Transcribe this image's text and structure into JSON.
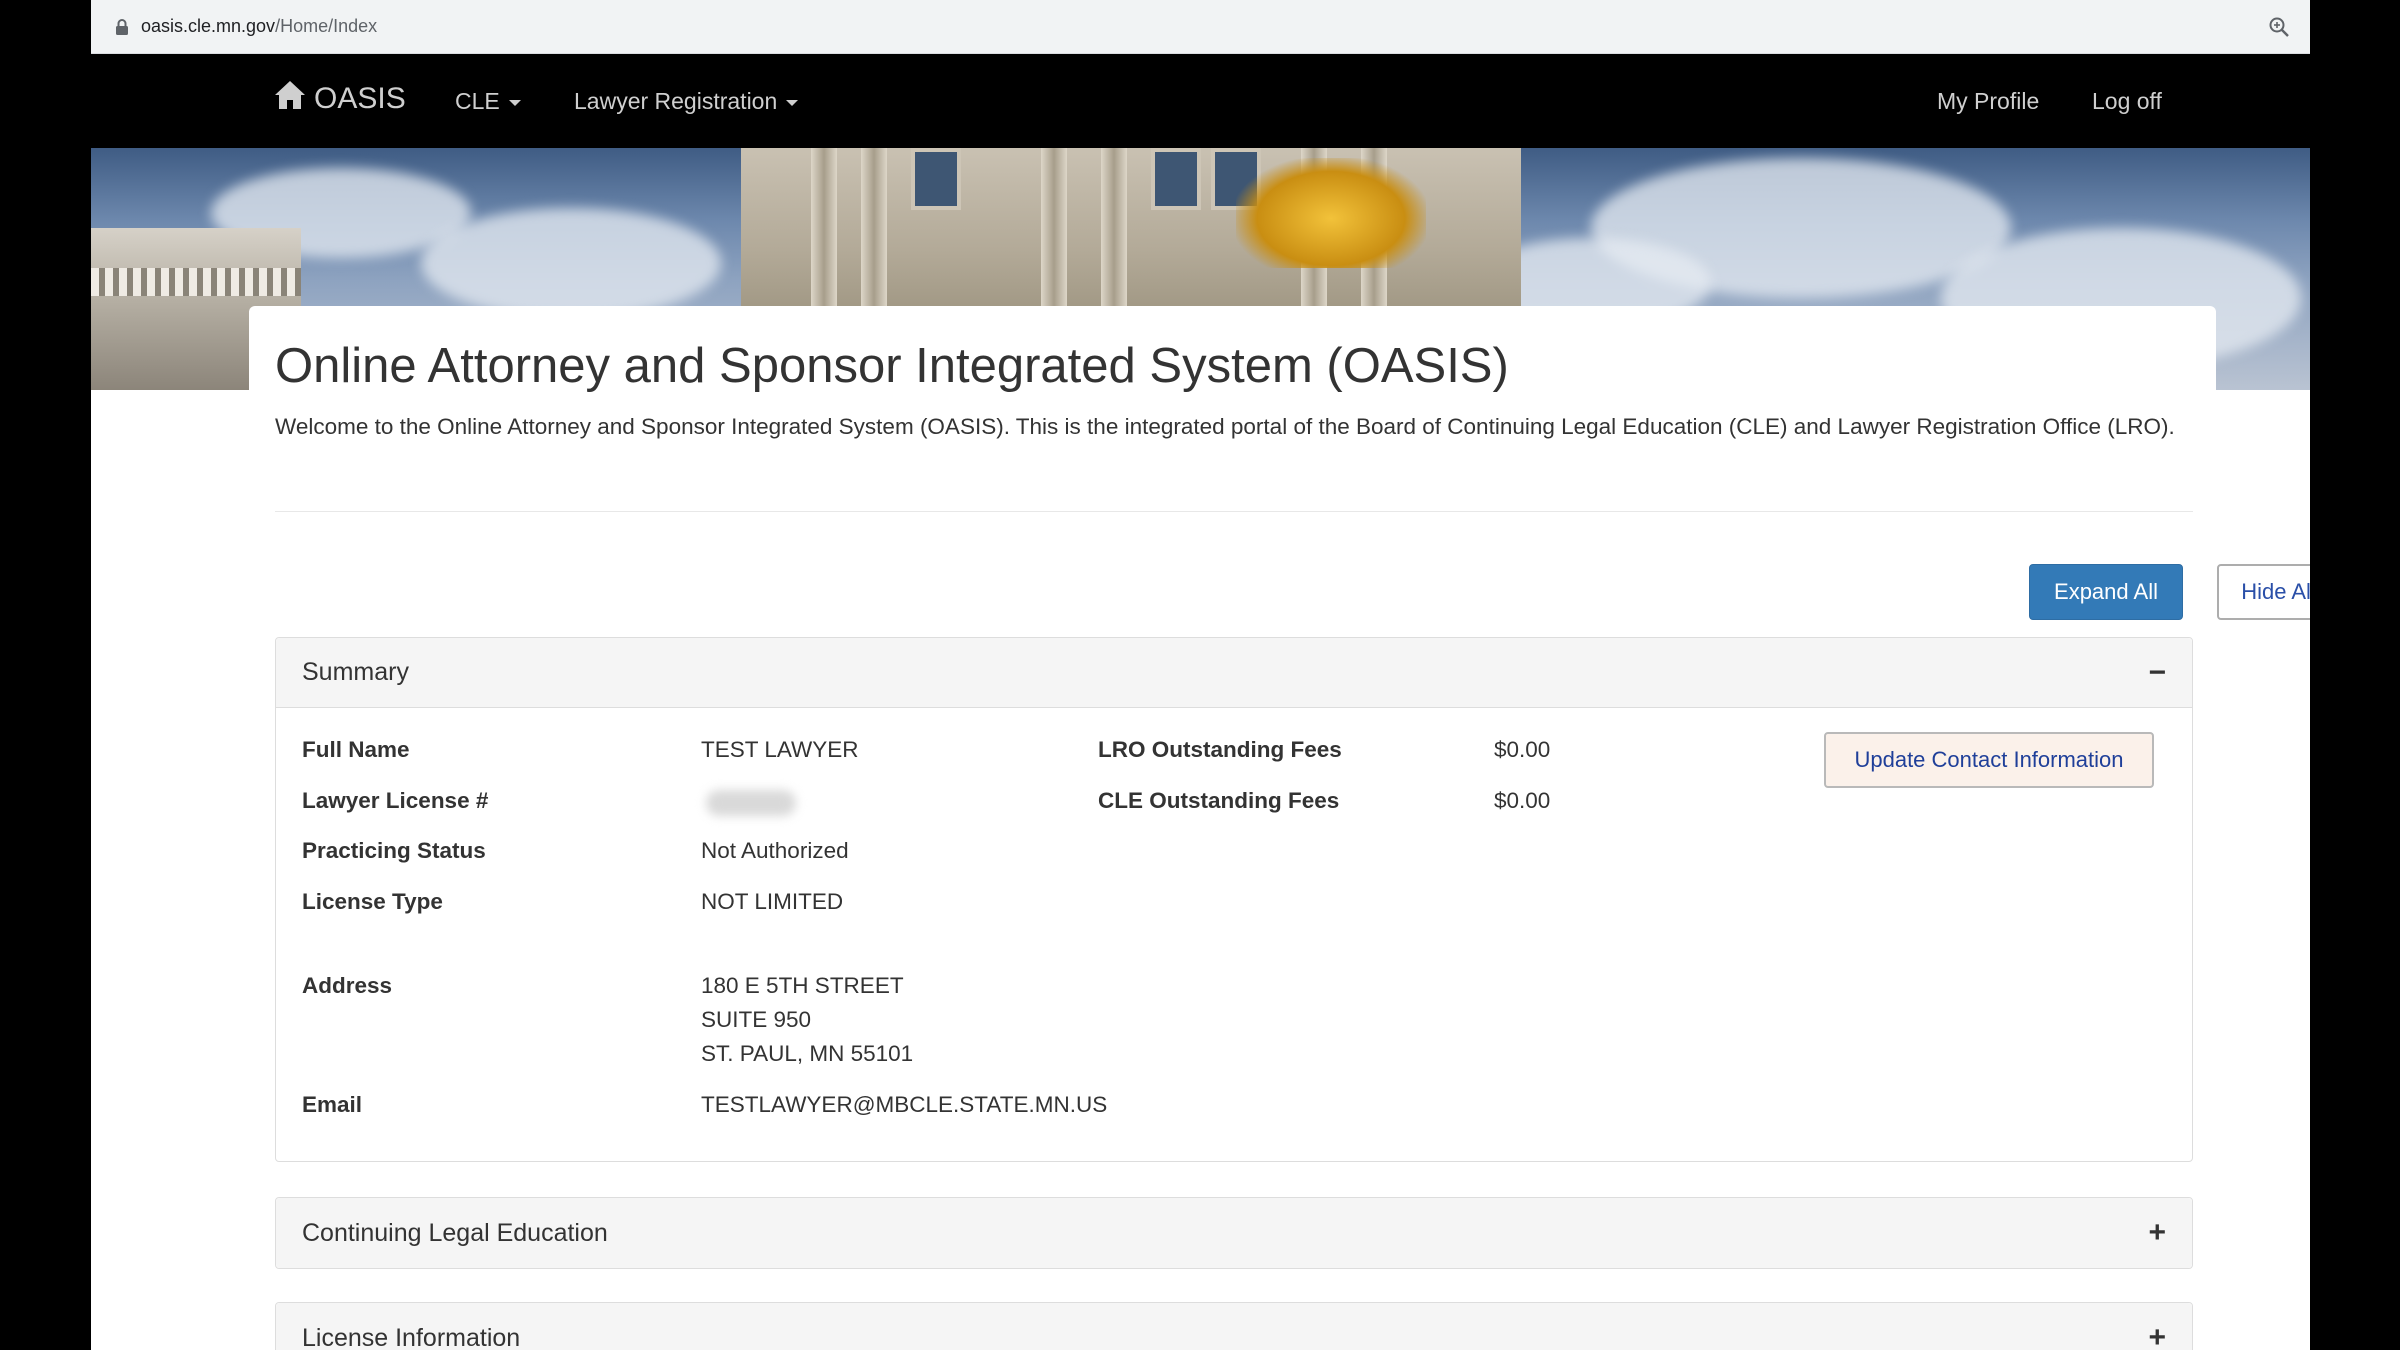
{
  "browser": {
    "url_domain": "oasis.cle.mn.gov",
    "url_path": "/Home/Index"
  },
  "navbar": {
    "brand": "OASIS",
    "menu_cle": "CLE",
    "menu_lawyer_registration": "Lawyer Registration",
    "my_profile": "My Profile",
    "log_off": "Log off"
  },
  "page": {
    "title": "Online Attorney and Sponsor Integrated System (OASIS)",
    "intro": "Welcome to the Online Attorney and Sponsor Integrated System (OASIS). This is the integrated portal of the Board of Continuing Legal Education (CLE) and Lawyer Registration Office (LRO)."
  },
  "actions": {
    "expand_all": "Expand All",
    "hide_all": "Hide All"
  },
  "summary": {
    "heading": "Summary",
    "toggle": "−",
    "update_button": "Update Contact Information",
    "fields": {
      "full_name_label": "Full Name",
      "full_name_value": "TEST LAWYER",
      "license_label": "Lawyer License #",
      "practicing_status_label": "Practicing Status",
      "practicing_status_value": "Not Authorized",
      "license_type_label": "License Type",
      "license_type_value": "NOT LIMITED",
      "address_label": "Address",
      "address_line1": "180 E 5TH STREET",
      "address_line2": "SUITE 950",
      "address_line3": "ST. PAUL, MN 55101",
      "email_label": "Email",
      "email_value": "TESTLAWYER@MBCLE.STATE.MN.US",
      "lro_fees_label": "LRO Outstanding Fees",
      "lro_fees_value": "$0.00",
      "cle_fees_label": "CLE Outstanding Fees",
      "cle_fees_value": "$0.00"
    }
  },
  "sections": {
    "cle_heading": "Continuing Legal Education",
    "license_heading": "License Information",
    "expand_toggle": "+"
  }
}
